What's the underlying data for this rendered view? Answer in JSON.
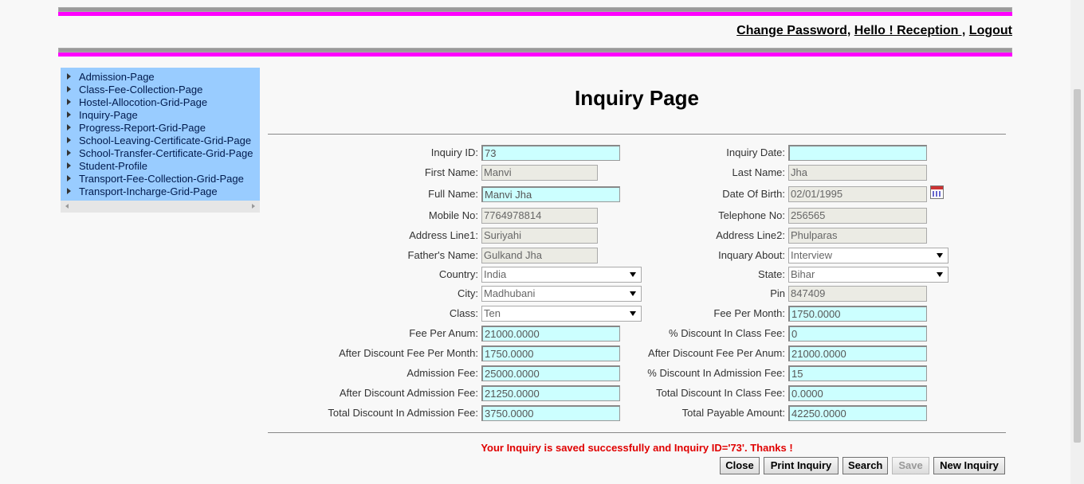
{
  "header": {
    "change_password": "Change Password,",
    "hello": "Hello ! Reception ,",
    "logout": "Logout"
  },
  "nav": {
    "items": [
      "Admission-Page",
      "Class-Fee-Collection-Page",
      "Hostel-Allocotion-Grid-Page",
      "Inquiry-Page",
      "Progress-Report-Grid-Page",
      "School-Leaving-Certificate-Grid-Page",
      "School-Transfer-Certificate-Grid-Page",
      "Student-Profile",
      "Transport-Fee-Collection-Grid-Page",
      "Transport-Incharge-Grid-Page"
    ]
  },
  "page_title": "Inquiry Page",
  "form": {
    "left": [
      {
        "label": "Inquiry ID:",
        "value": "73",
        "kind": "text-cyan"
      },
      {
        "label": "First Name:",
        "value": "Manvi",
        "kind": "text-grey"
      },
      {
        "label": "Full Name:",
        "value": "Manvi Jha",
        "kind": "text-cyan"
      },
      {
        "label": "Mobile No:",
        "value": "7764978814",
        "kind": "text-grey"
      },
      {
        "label": "Address Line1:",
        "value": "Suriyahi",
        "kind": "text-grey"
      },
      {
        "label": "Father's Name:",
        "value": "Gulkand Jha",
        "kind": "text-grey"
      },
      {
        "label": "Country:",
        "value": "India",
        "kind": "select"
      },
      {
        "label": "City:",
        "value": "Madhubani",
        "kind": "select"
      },
      {
        "label": "Class:",
        "value": "Ten",
        "kind": "select"
      },
      {
        "label": "Fee Per Anum:",
        "value": "21000.0000",
        "kind": "text-cyan"
      },
      {
        "label": "After Discount Fee Per Month:",
        "value": "1750.0000",
        "kind": "text-cyan"
      },
      {
        "label": "Admission Fee:",
        "value": "25000.0000",
        "kind": "text-cyan"
      },
      {
        "label": "After Discount Admission Fee:",
        "value": "21250.0000",
        "kind": "text-cyan"
      },
      {
        "label": "Total Discount In Admission Fee:",
        "value": "3750.0000",
        "kind": "text-cyan"
      }
    ],
    "right": [
      {
        "label": "Inquiry Date:",
        "value": "",
        "kind": "text-cyan"
      },
      {
        "label": "Last Name:",
        "value": "Jha",
        "kind": "text-grey"
      },
      {
        "label": "Date Of Birth:",
        "value": "02/01/1995",
        "kind": "text-grey"
      },
      {
        "label": "Telephone No:",
        "value": "256565",
        "kind": "text-grey"
      },
      {
        "label": "Address Line2:",
        "value": "Phulparas",
        "kind": "text-grey"
      },
      {
        "label": "Inquary About:",
        "value": "Interview",
        "kind": "select"
      },
      {
        "label": "State:",
        "value": "Bihar",
        "kind": "select"
      },
      {
        "label": "Pin",
        "value": "847409",
        "kind": "text-grey"
      },
      {
        "label": "Fee Per Month:",
        "value": "1750.0000",
        "kind": "text-cyan"
      },
      {
        "label": "% Discount In Class Fee:",
        "value": "0",
        "kind": "text-cyan"
      },
      {
        "label": "After Discount Fee Per Anum:",
        "value": "21000.0000",
        "kind": "text-cyan"
      },
      {
        "label": "% Discount In Admission Fee:",
        "value": "15",
        "kind": "text-cyan"
      },
      {
        "label": "Total Discount In Class Fee:",
        "value": "0.0000",
        "kind": "text-cyan"
      },
      {
        "label": "Total Payable Amount:",
        "value": "42250.0000",
        "kind": "text-cyan"
      }
    ]
  },
  "message": "Your Inquiry is saved successfully and Inquiry ID='73'. Thanks !",
  "buttons": {
    "close": "Close",
    "print": "Print Inquiry",
    "search": "Search",
    "save": "Save",
    "new": "New Inquiry"
  },
  "colors": {
    "accent_bar": "#ff00ff",
    "nav_bg": "#99ccff",
    "field_cyan": "#ccffff",
    "message": "#e00000"
  }
}
